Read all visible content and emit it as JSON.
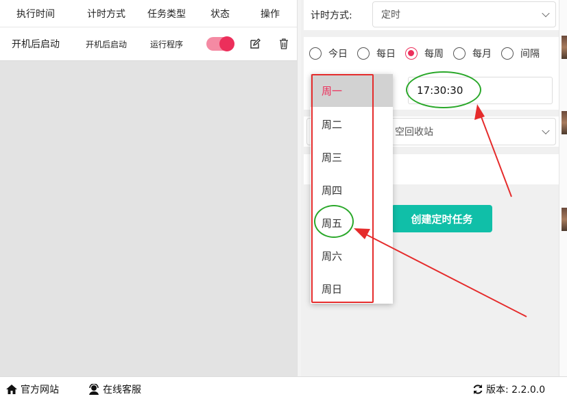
{
  "table": {
    "headers": [
      "执行时间",
      "计时方式",
      "任务类型",
      "状态",
      "操作"
    ],
    "row": {
      "exec_time": "开机后启动",
      "timing_mode": "开机后启动",
      "task_type": "运行程序",
      "status_on": true
    }
  },
  "form": {
    "timing_label": "计时方式:",
    "timing_value": "定时",
    "frequency_options": [
      "今日",
      "每日",
      "每周",
      "每月",
      "间隔"
    ],
    "frequency_selected": "每周",
    "time_value": "17:30:30",
    "task_select_partial": "空回收站",
    "create_button_label": "创建定时任务"
  },
  "weekday_dropdown": {
    "items": [
      "周一",
      "周二",
      "周三",
      "周四",
      "周五",
      "周六",
      "周日"
    ],
    "selected": "周一"
  },
  "footer": {
    "website_label": "官方网站",
    "support_label": "在线客服",
    "version_label": "版本: 2.2.0.0"
  },
  "colors": {
    "accent": "#ec2f5b",
    "button": "#10bfa8",
    "annotation_red": "#e52b2b",
    "annotation_green": "#2aa82a"
  }
}
